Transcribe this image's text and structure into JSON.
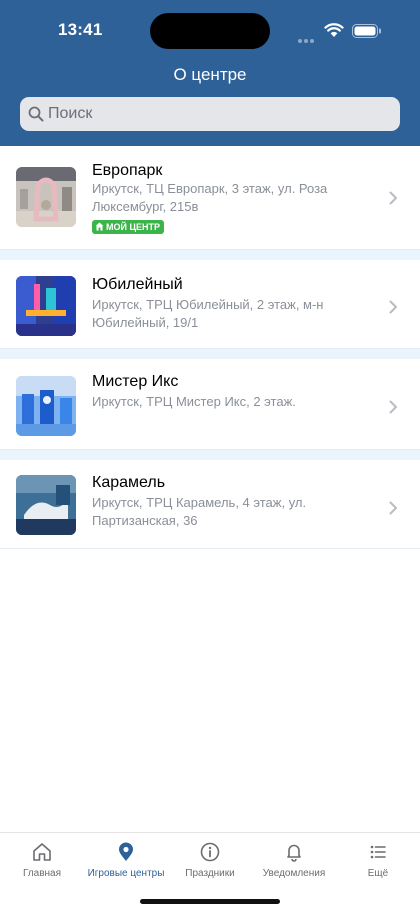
{
  "status_bar": {
    "time": "13:41",
    "icons": [
      "signal-dots-icon",
      "wifi-icon",
      "battery-icon"
    ]
  },
  "header": {
    "title": "О центре",
    "background": "#2f6199"
  },
  "search": {
    "placeholder": "Поиск",
    "value": "",
    "icon": "search-icon"
  },
  "centers": [
    {
      "name": "Европарк",
      "address": "Иркутск, ТЦ Европарк, 3 этаж, ул. Роза Люксембург, 215в",
      "badge": "МОЙ ЦЕНТР"
    },
    {
      "name": "Юбилейный",
      "address": "Иркутск, ТРЦ Юбилейный, 2 этаж, м-н Юбилейный, 19/1"
    },
    {
      "name": "Мистер Икс",
      "address": "Иркутск, ТРЦ Мистер Икс, 2 этаж."
    },
    {
      "name": "Карамель",
      "address": "Иркутск, ТРЦ Карамель, 4 этаж, ул. Партизанская, 36"
    }
  ],
  "tabbar": {
    "active_color": "#2f6199",
    "items": [
      {
        "label": "Главная",
        "icon": "home-icon"
      },
      {
        "label": "Игровые центры",
        "icon": "location-pin-icon",
        "active": true
      },
      {
        "label": "Праздники",
        "icon": "info-icon"
      },
      {
        "label": "Уведомления",
        "icon": "bell-icon"
      },
      {
        "label": "Ещё",
        "icon": "list-icon"
      }
    ]
  },
  "colors": {
    "badge": "#3bb54a",
    "divider": "#eaf4fc",
    "secondary_text": "#8a8f98"
  }
}
